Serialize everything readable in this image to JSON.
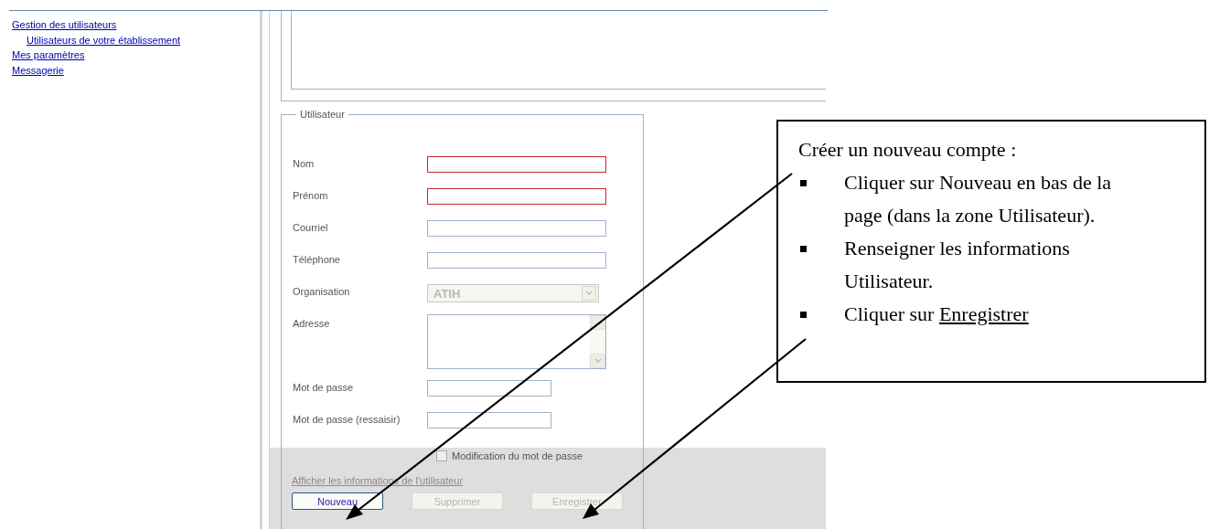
{
  "sidebar": {
    "items": [
      {
        "label": "Gestion des utilisateurs",
        "children": [
          {
            "label": "Utilisateurs de votre établissement"
          }
        ]
      },
      {
        "label": "Mes paramètres"
      },
      {
        "label": "Messagerie"
      }
    ]
  },
  "user_form": {
    "legend": "Utilisateur",
    "fields": [
      {
        "kind": "text",
        "label": "Nom",
        "invalid": true
      },
      {
        "kind": "text",
        "label": "Prénom",
        "invalid": true
      },
      {
        "kind": "text",
        "label": "Courriel",
        "invalid": false
      },
      {
        "kind": "text",
        "label": "Téléphone",
        "invalid": false
      },
      {
        "kind": "select",
        "label": "Organisation",
        "value": "ATIH",
        "disabled": true
      },
      {
        "kind": "textarea",
        "label": "Adresse",
        "invalid": false
      },
      {
        "kind": "password",
        "label": "Mot de passe",
        "invalid": false
      },
      {
        "kind": "password",
        "label": "Mot de passe (ressaisir)",
        "invalid": false
      }
    ],
    "checkbox": {
      "label": "Modification du mot de passe",
      "checked": false
    },
    "info_link": {
      "label": "Afficher les informations de l'utilisateur",
      "disabled": true
    },
    "buttons": [
      {
        "label": "Nouveau",
        "disabled": false
      },
      {
        "label": "Supprimer",
        "disabled": true
      },
      {
        "label": "Enregistrer",
        "disabled": true
      }
    ]
  },
  "callout": {
    "title": "Créer un nouveau compte :",
    "steps": [
      {
        "text": "Cliquer sur Nouveau en bas de la page (dans la zone Utilisateur)."
      },
      {
        "text": "Renseigner les informations Utilisateur."
      },
      {
        "text": "Cliquer sur",
        "link": "Enregistrer"
      }
    ]
  }
}
